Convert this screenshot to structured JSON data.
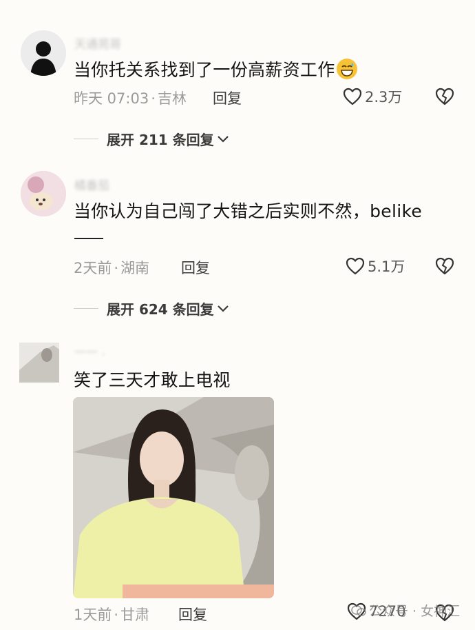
{
  "comments": [
    {
      "username": "天通苑哥",
      "text": "当你托关系找到了一份高薪资工作",
      "emoji": "grinning-sweat-emoji",
      "time": "昨天 07:03",
      "sep": "·",
      "location": "吉林",
      "reply_label": "回复",
      "likes": "2.3万",
      "expand_label": "展开 211 条回复"
    },
    {
      "username": "橘番茄",
      "text": "当你认为自己闯了大错之后实则不然，belike",
      "time": "2天前",
      "sep": "·",
      "location": "湖南",
      "reply_label": "回复",
      "likes": "5.1万",
      "expand_label": "展开 624 条回复"
    },
    {
      "username": "—— .",
      "text": "笑了三天才敢上电视",
      "time": "1天前",
      "sep": "·",
      "location": "甘肃",
      "reply_label": "回复",
      "likes": "7270"
    }
  ],
  "watermark": "公众号 · 女神汇",
  "colors": {
    "background": "#fdfcf8",
    "text": "#141414",
    "meta": "#9a9a9a",
    "emoji": "#f7c235"
  }
}
